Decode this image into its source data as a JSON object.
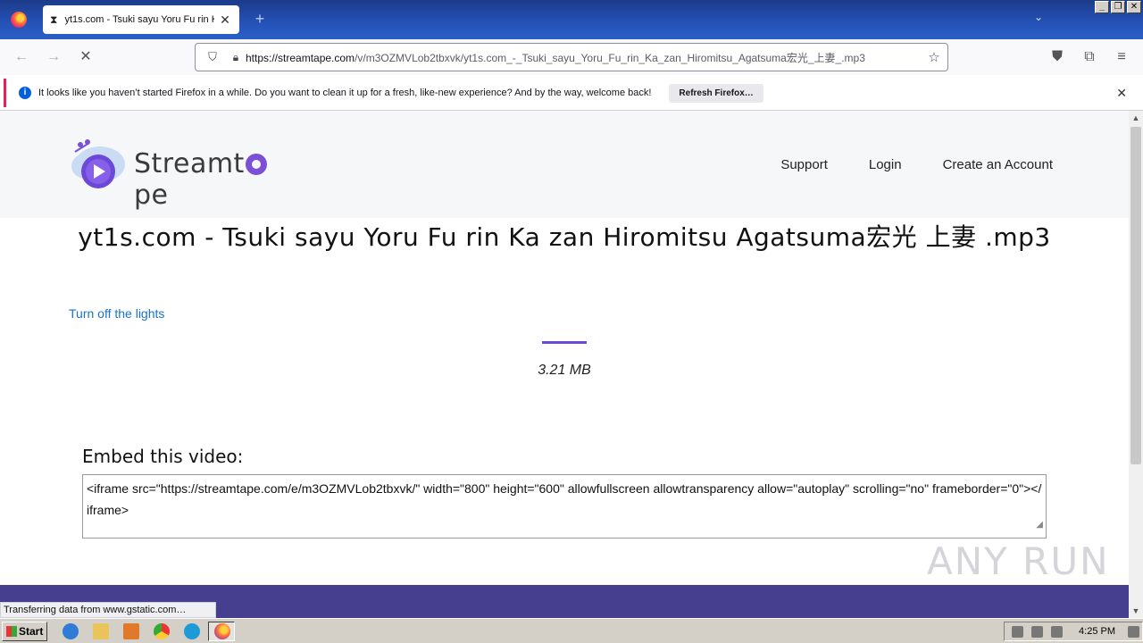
{
  "browser": {
    "tab_title": "yt1s.com - Tsuki sayu Yoru Fu rin K",
    "url_domain": "https://streamtape.com",
    "url_path": "/v/m3OZMVLob2tbxvk/yt1s.com_-_Tsuki_sayu_Yoru_Fu_rin_Ka_zan_Hiromitsu_Agatsuma宏光_上妻_.mp3",
    "notification_text": "It looks like you haven’t started Firefox in a while. Do you want to clean it up for a fresh, like-new experience? And by the way, welcome back!",
    "notification_button": "Refresh Firefox…",
    "status_text": "Transferring data from www.gstatic.com…"
  },
  "site": {
    "logo_text_before": "Streamt",
    "logo_text_after": "pe",
    "nav": [
      "Support",
      "Login",
      "Create an Account"
    ],
    "title": "yt1s.com - Tsuki sayu Yoru Fu rin Ka zan Hiromitsu Agatsuma宏光 上妻 .mp3",
    "lights_link": "Turn off the lights",
    "file_size": "3.21 MB",
    "embed_label": "Embed this video:",
    "embed_code": "<iframe src=\"https://streamtape.com/e/m3OZMVLob2tbxvk/\" width=\"800\" height=\"600\" allowfullscreen allowtransparency allow=\"autoplay\" scrolling=\"no\" frameborder=\"0\"></iframe>",
    "accent_color": "#6b48d8",
    "footer_color": "#463e8e"
  },
  "taskbar": {
    "start_label": "Start",
    "clock": "4:25 PM"
  },
  "watermark": "ANY RUN"
}
